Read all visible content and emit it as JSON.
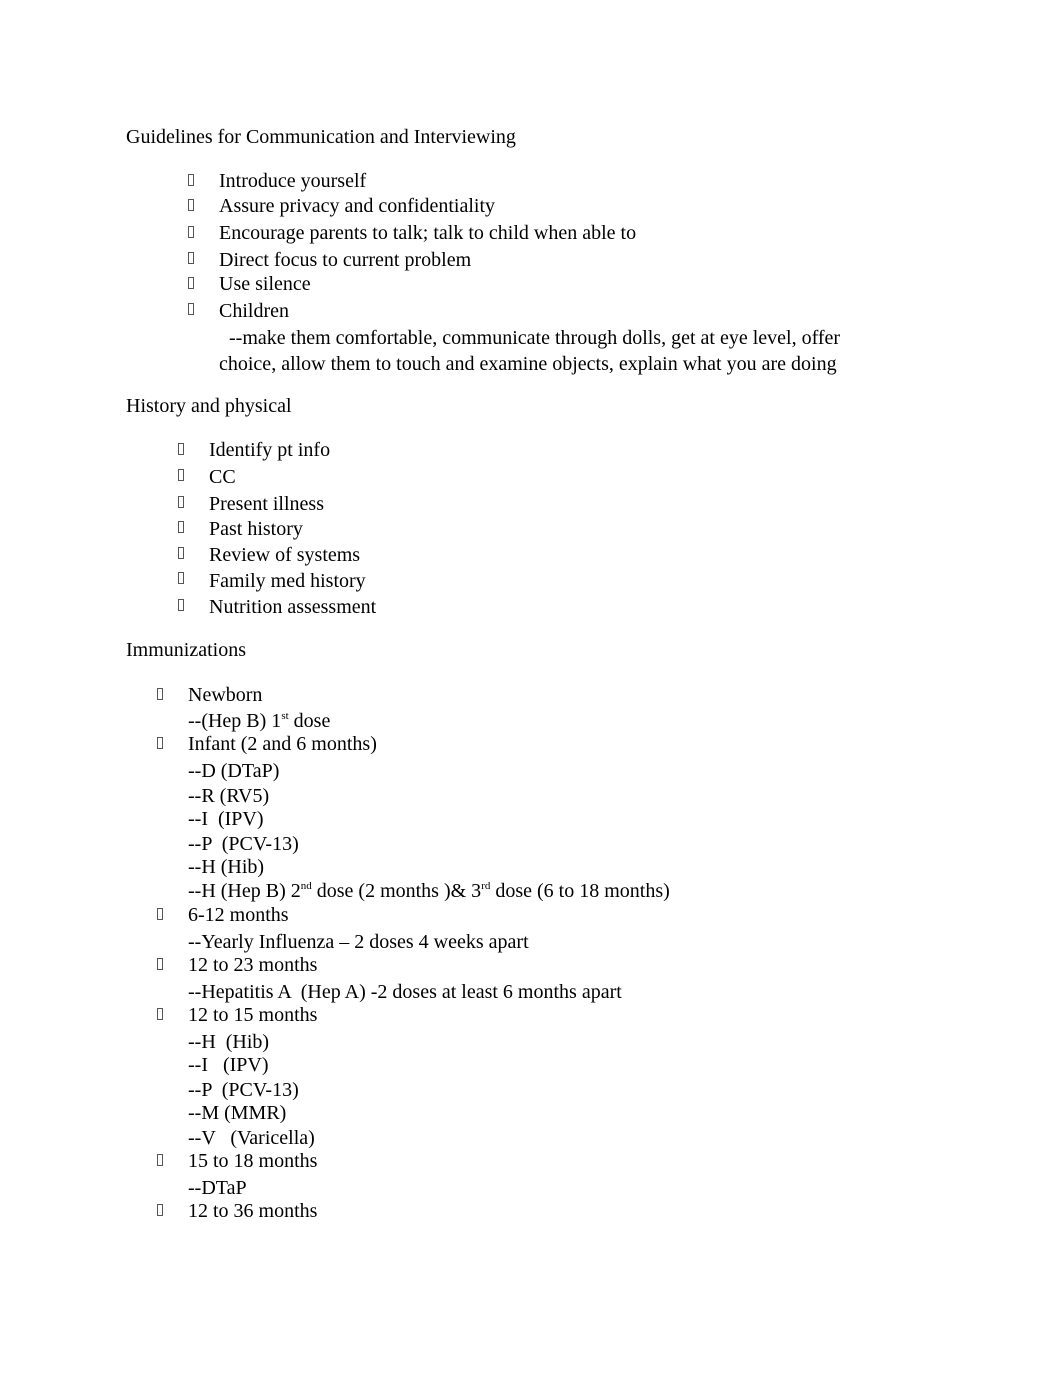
{
  "sections": [
    {
      "heading": "Guidelines for Communication and Interviewing",
      "items": [
        "Introduce yourself",
        "Assure privacy and confidentiality",
        "Encourage parents to talk; talk to child when able to",
        "Direct focus to current problem",
        "Use silence",
        "Children"
      ],
      "children_note_line1": "  --make them comfortable, communicate through dolls, get at eye level, offer",
      "children_note_line2": "choice, allow them to touch and examine objects, explain what you are doing"
    },
    {
      "heading": "History and physical",
      "items": [
        "Identify pt info",
        "CC",
        "Present illness",
        "Past history",
        "Review of systems",
        "Family med history",
        "Nutrition assessment"
      ]
    },
    {
      "heading": "Immunizations",
      "groups": [
        {
          "label": "Newborn",
          "subs": []
        },
        {
          "label": "Infant (2 and 6 months)",
          "subs": [
            "--D (DTaP)",
            "--R (RV5)",
            "--I  (IPV)",
            "--P  (PCV-13)",
            "--H (Hib)"
          ]
        },
        {
          "label": "6-12 months",
          "subs": [
            "--Yearly Influenza – 2 doses 4 weeks apart"
          ]
        },
        {
          "label": "12 to 23 months",
          "subs": [
            "--Hepatitis A  (Hep A) -2 doses at least 6 months apart"
          ]
        },
        {
          "label": "12 to 15 months",
          "subs": [
            "--H  (Hib)",
            "--I   (IPV)",
            "--P  (PCV-13)",
            "--M (MMR)",
            "--V   (Varicella)"
          ]
        },
        {
          "label": "15 to 18 months",
          "subs": [
            "--DTaP"
          ]
        },
        {
          "label": "12 to 36 months",
          "subs": []
        }
      ],
      "newborn_sub": {
        "pre": "--(Hep B) 1",
        "sup": "st",
        "post": " dose"
      },
      "hepb_sub": {
        "pre": "--H (Hep B) 2",
        "sup1": "nd",
        "mid": " dose (2 months )& 3",
        "sup2": "rd",
        "post": " dose (6 to 18 months)"
      }
    }
  ]
}
